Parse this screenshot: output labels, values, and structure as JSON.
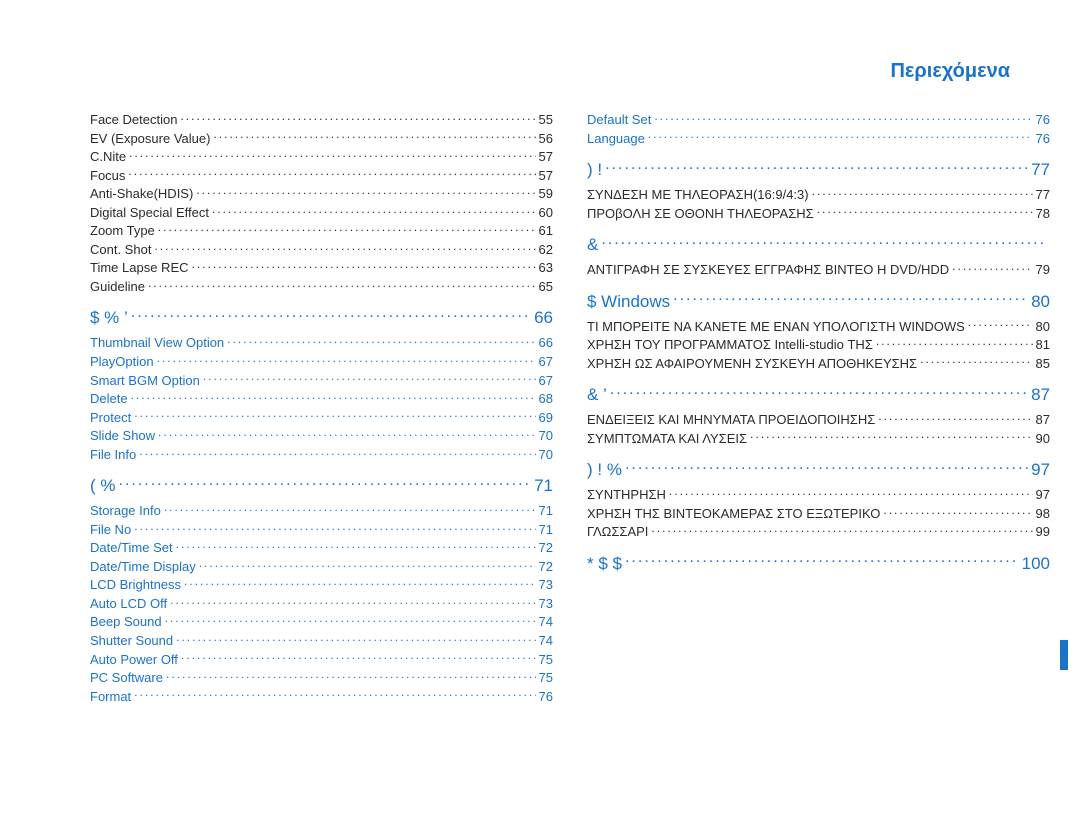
{
  "title": "Περιεχόμενα",
  "left": [
    {
      "kind": "item",
      "style": "black",
      "label": "Face Detection",
      "page": "55"
    },
    {
      "kind": "item",
      "style": "black",
      "label": "EV (Exposure Value)",
      "page": "56"
    },
    {
      "kind": "item",
      "style": "black",
      "label": "C.Nite",
      "page": "57"
    },
    {
      "kind": "item",
      "style": "black",
      "label": "Focus",
      "page": "57"
    },
    {
      "kind": "item",
      "style": "black",
      "label": "Anti-Shake(HDIS)",
      "page": "59"
    },
    {
      "kind": "item",
      "style": "black",
      "label": "Digital Special Effect",
      "page": "60"
    },
    {
      "kind": "item",
      "style": "black",
      "label": "Zoom Type",
      "page": "61"
    },
    {
      "kind": "item",
      "style": "black",
      "label": "Cont. Shot",
      "page": "62"
    },
    {
      "kind": "item",
      "style": "black",
      "label": "Time Lapse REC",
      "page": "63"
    },
    {
      "kind": "item",
      "style": "black",
      "label": "Guideline",
      "page": "65"
    },
    {
      "kind": "heading",
      "label": "       $       %              ’",
      "page": "66"
    },
    {
      "kind": "item",
      "style": "blue",
      "label": "Thumbnail View Option",
      "page": "66"
    },
    {
      "kind": "item",
      "style": "blue",
      "label": "PlayOption",
      "page": "67"
    },
    {
      "kind": "item",
      "style": "blue",
      "label": "Smart BGM Option",
      "page": "67"
    },
    {
      "kind": "item",
      "style": "blue",
      "label": "Delete",
      "page": "68"
    },
    {
      "kind": "item",
      "style": "blue",
      "label": "Protect",
      "page": "69"
    },
    {
      "kind": "item",
      "style": "blue",
      "label": "Slide Show",
      "page": "70"
    },
    {
      "kind": "item",
      "style": "blue",
      "label": "File Info",
      "page": "70"
    },
    {
      "kind": "heading",
      "label": "(          %",
      "page": "71"
    },
    {
      "kind": "item",
      "style": "blue",
      "label": "Storage Info",
      "page": "71"
    },
    {
      "kind": "item",
      "style": "blue",
      "label": "File No",
      "page": "71"
    },
    {
      "kind": "item",
      "style": "blue",
      "label": "Date/Time Set",
      "page": "72"
    },
    {
      "kind": "item",
      "style": "blue",
      "label": "Date/Time Display",
      "page": "72"
    },
    {
      "kind": "item",
      "style": "blue",
      "label": "LCD Brightness",
      "page": "73"
    },
    {
      "kind": "item",
      "style": "blue",
      "label": "Auto LCD Off",
      "page": "73"
    },
    {
      "kind": "item",
      "style": "blue",
      "label": "Beep Sound",
      "page": "74"
    },
    {
      "kind": "item",
      "style": "blue",
      "label": "Shutter Sound",
      "page": "74"
    },
    {
      "kind": "item",
      "style": "blue",
      "label": "Auto Power Off",
      "page": "75"
    },
    {
      "kind": "item",
      "style": "blue",
      "label": "PC Software",
      "page": "75"
    },
    {
      "kind": "item",
      "style": "blue",
      "label": "Format",
      "page": "76"
    }
  ],
  "right": [
    {
      "kind": "item",
      "style": "blue",
      "label": "Default Set",
      "page": "76"
    },
    {
      "kind": "item",
      "style": "blue",
      "label": "Language",
      "page": "76"
    },
    {
      "kind": "heading",
      "label": ")               !",
      "page": "77"
    },
    {
      "kind": "item",
      "style": "black",
      "label": "ΣΥΝΔΕΣΗ ΜΕ ΤΗΛΕΟΡΑΣΗ(16:9/4:3)",
      "page": "77"
    },
    {
      "kind": "item",
      "style": "black",
      "label": "ΠΡΟβΟΛΗ ΣΕ ΟΘΟΝΗ ΤΗΛΕΟΡΑΣΗΣ",
      "page": "78"
    },
    {
      "kind": "heading",
      "label": "&              ",
      "page": ""
    },
    {
      "kind": "item",
      "style": "black",
      "label": "ΑΝΤΙΓΡΑΦΗ ΣΕ ΣΥΣΚΕΥΕΣ ΕΓΓΡΑΦΗΣ ΒΙΝΤΕΟ Η DVD/HDD",
      "page": "79"
    },
    {
      "kind": "heading",
      "label": "        $                    Windows",
      "page": "80"
    },
    {
      "kind": "item",
      "style": "black",
      "label": "ΤΙ ΜΠΟΡΕΙΤΕ ΝΑ ΚΑΝΕΤΕ ΜΕ ΕΝΑΝ ΥΠΟΛΟΓΙΣΤΗ WINDOWS",
      "page": "80"
    },
    {
      "kind": "item",
      "style": "black",
      "label": "ΧΡΗΣΗ ΤΟΥ ΠΡΟΓΡΑΜΜΑΤΟΣ Intelli-studio ΤΗΣ",
      "page": "81"
    },
    {
      "kind": "item",
      "style": "black",
      "label": "ΧΡΗΣΗ ΩΣ ΑΦΑΙΡΟΥΜΕΝΗ ΣΥΣΚΕΥΗ ΑΠΟΘΗΚΕΥΣΗΣ",
      "page": "85"
    },
    {
      "kind": "heading",
      "label": "&                    ’",
      "page": "87"
    },
    {
      "kind": "item",
      "style": "black",
      "label": "ΕΝΔΕΙΞΕΙΣ ΚΑΙ ΜΗΝΥΜΑΤΑ ΠΡΟΕΙΔΟΠΟΙΗΣΗΣ",
      "page": "87"
    },
    {
      "kind": "item",
      "style": "black",
      "label": "ΣΥΜΠΤΩΜΑΤΑ ΚΑΙ ΛΥΣΕΙΣ",
      "page": "90"
    },
    {
      "kind": "heading",
      "label": ")                      ! %",
      "page": "97"
    },
    {
      "kind": "item",
      "style": "black",
      "label": "ΣΥΝΤΗΡΗΣΗ",
      "page": "97"
    },
    {
      "kind": "item",
      "style": "black",
      "label": "ΧΡΗΣΗ ΤΗΣ ΒΙΝΤΕΟΚΑΜΕΡΑΣ ΣΤΟ ΕΞΩΤΕΡΙΚΟ",
      "page": "98"
    },
    {
      "kind": "item",
      "style": "black",
      "label": "ΓΛΩΣΣΑΡΙ",
      "page": "99"
    },
    {
      "kind": "heading",
      "label": "*        $            $",
      "page": "100"
    }
  ]
}
